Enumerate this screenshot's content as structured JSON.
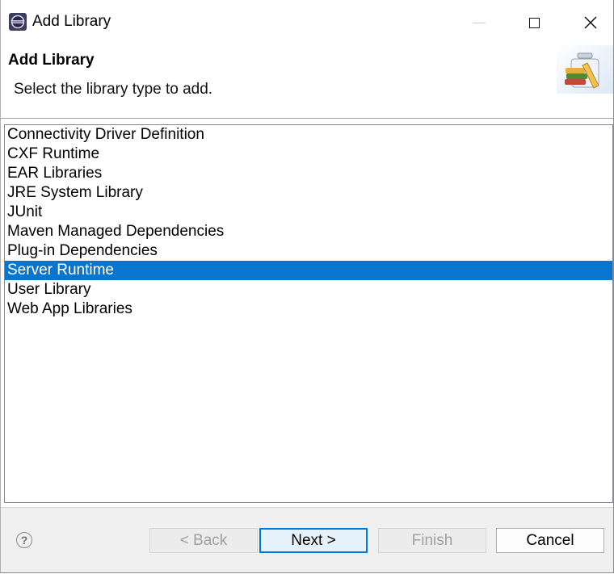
{
  "window": {
    "title": "Add Library",
    "app_icon": "eclipse-icon",
    "controls": [
      "minimize-icon",
      "maximize-icon",
      "close-icon"
    ]
  },
  "header": {
    "title": "Add Library",
    "description": "Select the library type to add.",
    "banner_icon": "library-jar-books-icon"
  },
  "libraries": {
    "items": [
      "Connectivity Driver Definition",
      "CXF Runtime",
      "EAR Libraries",
      "JRE System Library",
      "JUnit",
      "Maven Managed Dependencies",
      "Plug-in Dependencies",
      "Server Runtime",
      "User Library",
      "Web App Libraries"
    ],
    "selected": "Server Runtime"
  },
  "footer": {
    "help_icon": "help-question-icon",
    "help_glyph": "?",
    "back_label": "< Back",
    "next_label": "Next >",
    "finish_label": "Finish",
    "cancel_label": "Cancel"
  },
  "colors": {
    "selection": "#0a75cf",
    "default_button_border": "#0078d7",
    "footer_bg": "#f0f0f0"
  }
}
